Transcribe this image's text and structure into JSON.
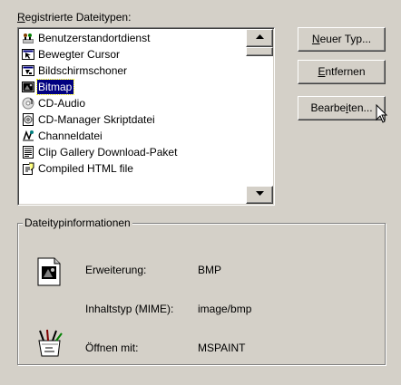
{
  "list": {
    "label_prefix": "R",
    "label_rest": "egistrierte Dateitypen:",
    "items": [
      {
        "label": "Benutzerstandortdienst",
        "icon": "network-users-icon"
      },
      {
        "label": "Bewegter Cursor",
        "icon": "animated-cursor-icon"
      },
      {
        "label": "Bildschirmschoner",
        "icon": "screensaver-icon"
      },
      {
        "label": "Bitmap",
        "icon": "bitmap-icon",
        "selected": true
      },
      {
        "label": "CD-Audio",
        "icon": "cd-audio-icon"
      },
      {
        "label": "CD-Manager Skriptdatei",
        "icon": "cd-script-icon"
      },
      {
        "label": "Channeldatei",
        "icon": "channel-file-icon"
      },
      {
        "label": "Clip Gallery Download-Paket",
        "icon": "clip-gallery-icon"
      },
      {
        "label": "Compiled HTML file",
        "icon": "chm-file-icon"
      }
    ]
  },
  "scrollbar": {
    "up_icon": "scroll-up-arrow-icon",
    "down_icon": "scroll-down-arrow-icon"
  },
  "buttons": {
    "new_type": {
      "underlined": "N",
      "rest": "euer Typ..."
    },
    "remove": {
      "underlined": "E",
      "rest": "ntfernen"
    },
    "edit": {
      "pre": "Bearbe",
      "underlined": "i",
      "post": "ten..."
    }
  },
  "group": {
    "title": "Dateitypinformationen",
    "extension_label": "Erweiterung:",
    "extension_value": "BMP",
    "mime_label": "Inhaltstyp (MIME):",
    "mime_value": "image/bmp",
    "open_with_label": "Öffnen mit:",
    "open_with_value": "MSPAINT"
  },
  "colors": {
    "face": "#d4d0c8",
    "selection": "#000080",
    "selection_text": "#ffffff"
  }
}
